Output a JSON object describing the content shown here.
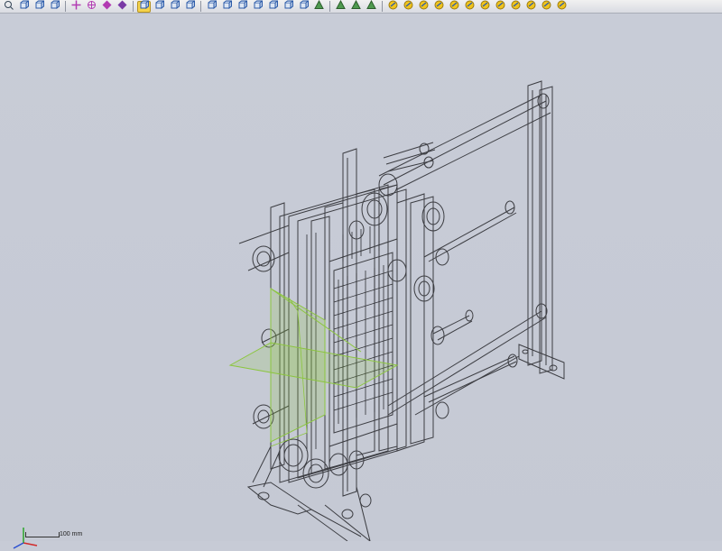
{
  "toolbar": {
    "buttons": [
      {
        "icon": "zoom-to-fit-icon"
      },
      {
        "icon": "zoom-to-area-icon"
      },
      {
        "icon": "zoom-in-out-icon"
      },
      {
        "icon": "zoom-to-selection-icon"
      },
      {
        "icon": "pan-icon"
      },
      {
        "icon": "rotate-view-icon"
      },
      {
        "icon": "roll-view-icon"
      },
      {
        "icon": "view-orientation-icon"
      },
      {
        "icon": "wireframe-icon",
        "active": true
      },
      {
        "icon": "hidden-lines-visible-icon"
      },
      {
        "icon": "hidden-lines-removed-icon"
      },
      {
        "icon": "shaded-with-edges-icon"
      },
      {
        "icon": "front-view-icon"
      },
      {
        "icon": "back-view-icon"
      },
      {
        "icon": "left-view-icon"
      },
      {
        "icon": "right-view-icon"
      },
      {
        "icon": "top-view-icon"
      },
      {
        "icon": "bottom-view-icon"
      },
      {
        "icon": "isometric-view-icon"
      },
      {
        "icon": "normal-to-icon"
      },
      {
        "icon": "shadows-icon"
      },
      {
        "icon": "perspective-icon"
      },
      {
        "icon": "section-view-icon"
      },
      {
        "icon": "sketch-toggle-icon"
      },
      {
        "icon": "hide-show-planes-icon"
      },
      {
        "icon": "hide-show-axes-icon"
      },
      {
        "icon": "hide-show-temp-axes-icon"
      },
      {
        "icon": "hide-show-origins-icon"
      },
      {
        "icon": "hide-show-coordinate-systems-icon"
      },
      {
        "icon": "hide-show-curves-icon"
      },
      {
        "icon": "hide-show-sketches-icon"
      },
      {
        "icon": "hide-show-3d-sketch-planes-icon"
      },
      {
        "icon": "hide-show-dimension-names-icon"
      },
      {
        "icon": "hide-show-points-icon"
      },
      {
        "icon": "hide-show-lights-icon"
      }
    ]
  },
  "viewport": {
    "scale_label": "100 mm",
    "triad": {
      "x_color": "#d22a2a",
      "y_color": "#2aa52a",
      "z_color": "#2a4fd2"
    },
    "plane_color": "#8cc63f",
    "wire_color": "#3a3a3a"
  }
}
